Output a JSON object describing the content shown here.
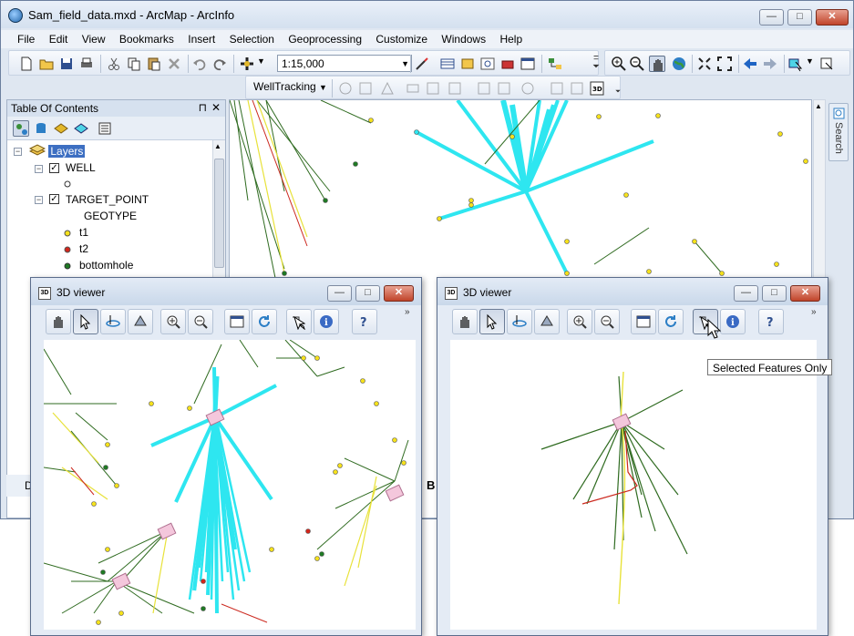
{
  "app": {
    "title": "Sam_field_data.mxd - ArcMap - ArcInfo",
    "caption_min": "—",
    "caption_max": "□",
    "caption_close": "✕"
  },
  "menu": [
    "File",
    "Edit",
    "View",
    "Bookmarks",
    "Insert",
    "Selection",
    "Geoprocessing",
    "Customize",
    "Windows",
    "Help"
  ],
  "toolbar": {
    "scale_value": "1:15,000",
    "well_tracking_label": "WellTracking"
  },
  "toc": {
    "title": "Table Of Contents",
    "pin": "⊓",
    "close": "✕",
    "root": "Layers",
    "layers": [
      {
        "name": "WELL",
        "checked": true
      },
      {
        "name": "TARGET_POINT",
        "checked": true
      }
    ],
    "geotype_label": "GEOTYPE",
    "legend": [
      {
        "label": "t1",
        "color": "#f5e11c"
      },
      {
        "label": "t2",
        "color": "#d3261b"
      },
      {
        "label": "bottomhole",
        "color": "#1f7a24"
      }
    ]
  },
  "search_tab": "Search",
  "viewer_left": {
    "title": "3D viewer"
  },
  "viewer_right": {
    "title": "3D viewer"
  },
  "tooltip": "Selected Features Only",
  "status_left": "D",
  "behind_label": "B",
  "colors": {
    "cyan": "#2ee6f0",
    "green_line": "#2f6b20",
    "yellow_line": "#e8e23a",
    "red_line": "#cc2a20",
    "pink_box": "#f4c7dc"
  }
}
